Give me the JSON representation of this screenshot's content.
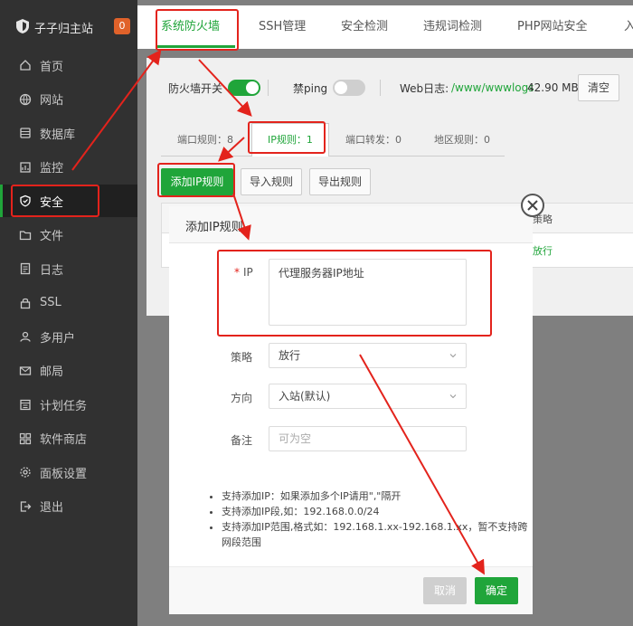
{
  "sidebar": {
    "brand": "子子归主站",
    "badge": "0",
    "items": [
      {
        "label": "首页",
        "icon": "home-icon"
      },
      {
        "label": "网站",
        "icon": "globe-icon"
      },
      {
        "label": "数据库",
        "icon": "database-icon"
      },
      {
        "label": "监控",
        "icon": "monitor-icon"
      },
      {
        "label": "安全",
        "icon": "shield-icon"
      },
      {
        "label": "文件",
        "icon": "folder-icon"
      },
      {
        "label": "日志",
        "icon": "log-icon"
      },
      {
        "label": "SSL",
        "icon": "lock-icon"
      },
      {
        "label": "多用户",
        "icon": "users-icon"
      },
      {
        "label": "邮局",
        "icon": "mail-icon"
      },
      {
        "label": "计划任务",
        "icon": "calendar-icon"
      },
      {
        "label": "软件商店",
        "icon": "apps-icon"
      },
      {
        "label": "面板设置",
        "icon": "gear-icon"
      },
      {
        "label": "退出",
        "icon": "logout-icon"
      }
    ],
    "active_index": 4
  },
  "tabs": [
    "系统防火墙",
    "SSH管理",
    "安全检测",
    "违规词检测",
    "PHP网站安全",
    "入"
  ],
  "top_row": {
    "firewall_label": "防火墙开关",
    "ping_label": "禁ping",
    "weblog_label": "Web日志:",
    "weblog_path": "/www/wwwlogs",
    "weblog_size": "42.90 MB",
    "clear_button": "清空"
  },
  "subtabs": [
    "端口规则：8",
    "IP规则：1",
    "端口转发：0",
    "地区规则：0"
  ],
  "actions": {
    "add_ip": "添加IP规则",
    "import": "导入规则",
    "export": "导出规则"
  },
  "background_table": {
    "header_partial": "策略",
    "cell_partial": "放行"
  },
  "modal": {
    "title": "添加IP规则",
    "ip_label": "IP",
    "ip_required_mark": "*",
    "ip_placeholder": "代理服务器IP地址",
    "policy_label": "策略",
    "policy_value": "放行",
    "direction_label": "方向",
    "direction_value": "入站(默认)",
    "note_label": "备注",
    "note_placeholder": "可为空",
    "tips": [
      "支持添加IP：如果添加多个IP请用\",\"隔开",
      "支持添加IP段,如：192.168.0.0/24",
      "支持添加IP范围,格式如：192.168.1.xx-192.168.1.xx，暂不支持跨网段范围"
    ],
    "cancel": "取消",
    "confirm": "确定"
  },
  "colors": {
    "accent_green": "#20a53a",
    "annotation_red": "#e3231c",
    "badge_orange": "#e0622a"
  }
}
